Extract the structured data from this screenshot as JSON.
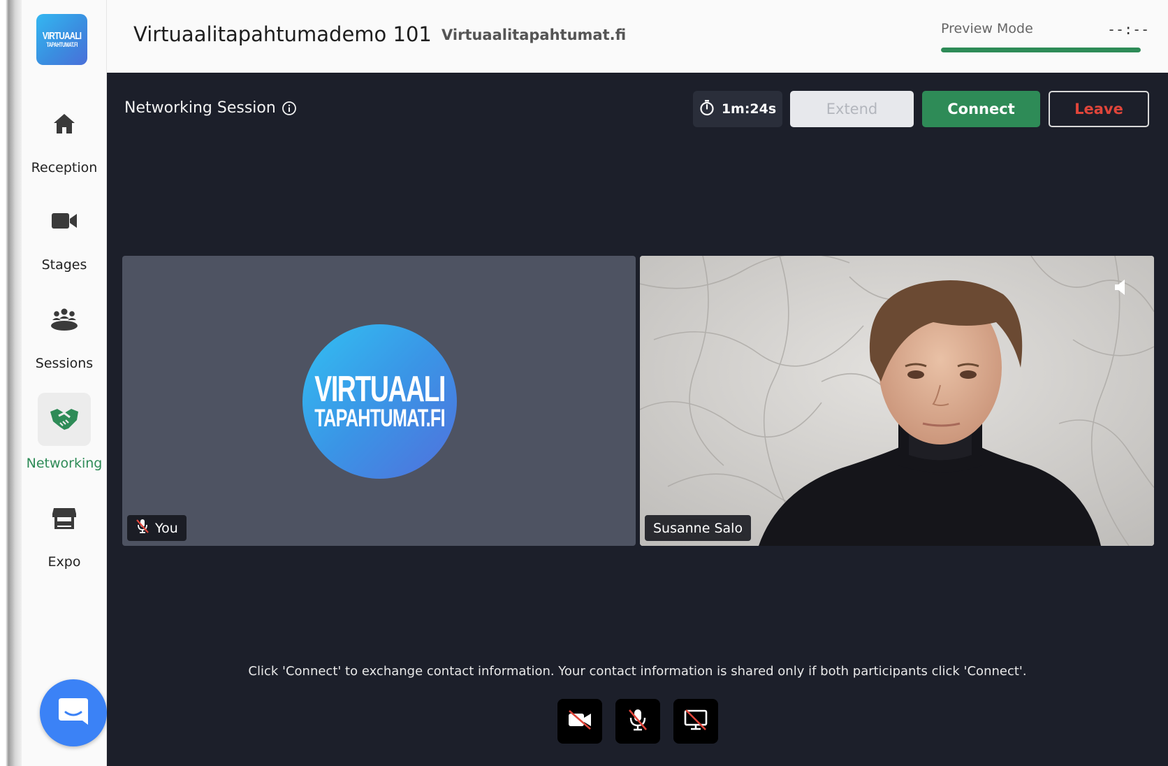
{
  "brand": {
    "logo_line1": "VIRTUAALI",
    "logo_line2": "TAPAHTUMAT.FI",
    "accent_green": "#2e8b57",
    "accent_blue": "#3b82f6"
  },
  "sidebar": {
    "items": [
      {
        "label": "Reception",
        "icon": "home-icon"
      },
      {
        "label": "Stages",
        "icon": "video-camera-icon"
      },
      {
        "label": "Sessions",
        "icon": "group-icon"
      },
      {
        "label": "Networking",
        "icon": "handshake-icon",
        "active": true
      },
      {
        "label": "Expo",
        "icon": "booth-icon"
      }
    ],
    "chat_icon": "chat-icon"
  },
  "header": {
    "event_title": "Virtuaalitapahtumademo 101",
    "organizer": "Virtuaalitapahtumat.fi",
    "preview_mode_label": "Preview Mode",
    "preview_time": "--:--",
    "preview_progress": 1.0
  },
  "session": {
    "title": "Networking Session",
    "timer": "1m:24s",
    "extend_label": "Extend",
    "connect_label": "Connect",
    "leave_label": "Leave"
  },
  "tiles": {
    "you": {
      "name": "You",
      "muted": true,
      "avatar_line1": "VIRTUAALI",
      "avatar_line2": "TAPAHTUMAT.FI"
    },
    "remote": {
      "name": "Susanne Salo"
    }
  },
  "footer": {
    "hint": "Click 'Connect' to exchange contact information. Your contact information is shared only if both participants click 'Connect'.",
    "controls": [
      "camera-off-icon",
      "mic-off-icon",
      "screen-share-off-icon"
    ]
  }
}
